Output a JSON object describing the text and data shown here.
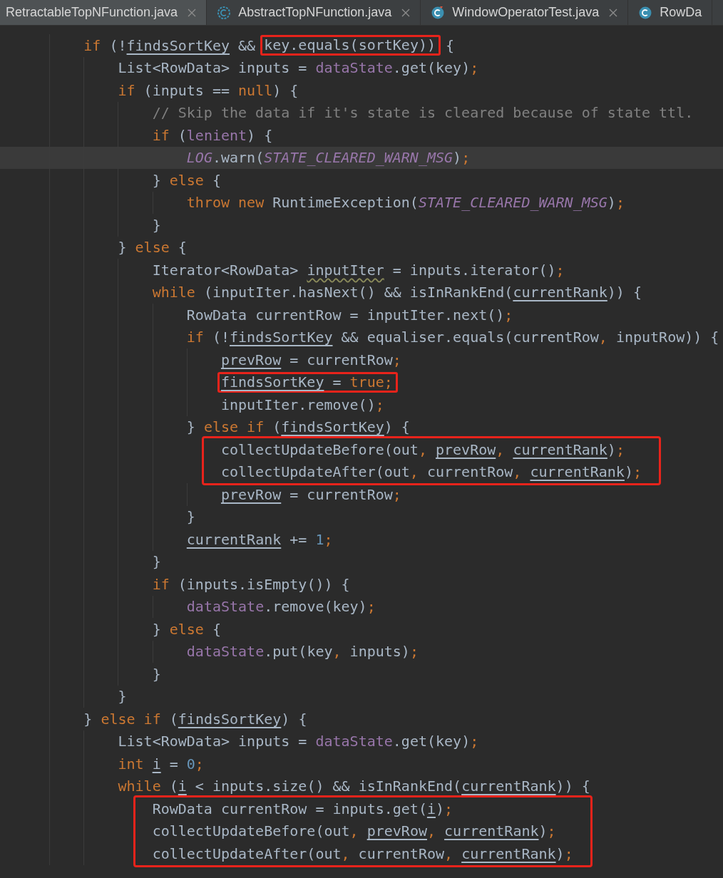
{
  "tabs": [
    {
      "label": "RetractableTopNFunction.java",
      "selected": true,
      "closable": true,
      "kind": "plain"
    },
    {
      "label": "AbstractTopNFunction.java",
      "selected": false,
      "closable": true,
      "kind": "abstract"
    },
    {
      "label": "WindowOperatorTest.java",
      "selected": false,
      "closable": true,
      "kind": "test"
    },
    {
      "label": "RowDa",
      "selected": false,
      "closable": false,
      "kind": "class"
    }
  ],
  "code": [
    {
      "kind": "line",
      "tokens": [
        {
          "kind": "k",
          "text": "if"
        },
        {
          "kind": "t",
          "text": " (!"
        },
        {
          "kind": "u",
          "text": "findsSortKey"
        },
        {
          "kind": "t",
          "text": " && "
        },
        {
          "kind": "box",
          "tokens": [
            {
              "kind": "t",
              "text": "key.equals(sortKey))"
            }
          ]
        },
        {
          "kind": "t",
          "text": " {"
        }
      ],
      "children": [
        {
          "kind": "line",
          "tokens": [
            {
              "kind": "t",
              "text": "List<RowData> inputs = "
            },
            {
              "kind": "f",
              "text": "dataState"
            },
            {
              "kind": "t",
              "text": ".get(key)"
            },
            {
              "kind": "p",
              "text": ";"
            }
          ]
        },
        {
          "kind": "line",
          "tokens": [
            {
              "kind": "k",
              "text": "if"
            },
            {
              "kind": "t",
              "text": " (inputs == "
            },
            {
              "kind": "k",
              "text": "null"
            },
            {
              "kind": "t",
              "text": ") {"
            }
          ],
          "children": [
            {
              "kind": "line",
              "tokens": [
                {
                  "kind": "c",
                  "text": "// Skip the data if it's state is cleared because of state ttl."
                }
              ]
            },
            {
              "kind": "line",
              "tokens": [
                {
                  "kind": "k",
                  "text": "if"
                },
                {
                  "kind": "t",
                  "text": " ("
                },
                {
                  "kind": "f",
                  "text": "lenient"
                },
                {
                  "kind": "t",
                  "text": ") {"
                }
              ],
              "children": [
                {
                  "kind": "line",
                  "current": true,
                  "tokens": [
                    {
                      "kind": "s",
                      "text": "LOG"
                    },
                    {
                      "kind": "t",
                      "text": ".warn("
                    },
                    {
                      "kind": "s",
                      "text": "STATE_CLEARED_WARN_MSG"
                    },
                    {
                      "kind": "t",
                      "text": ")"
                    },
                    {
                      "kind": "p",
                      "text": ";"
                    }
                  ]
                }
              ]
            },
            {
              "kind": "line",
              "tokens": [
                {
                  "kind": "t",
                  "text": "} "
                },
                {
                  "kind": "k",
                  "text": "else"
                },
                {
                  "kind": "t",
                  "text": " {"
                }
              ],
              "children": [
                {
                  "kind": "line",
                  "tokens": [
                    {
                      "kind": "k",
                      "text": "throw new"
                    },
                    {
                      "kind": "t",
                      "text": " RuntimeException("
                    },
                    {
                      "kind": "s",
                      "text": "STATE_CLEARED_WARN_MSG"
                    },
                    {
                      "kind": "t",
                      "text": ")"
                    },
                    {
                      "kind": "p",
                      "text": ";"
                    }
                  ]
                }
              ]
            },
            {
              "kind": "line",
              "tokens": [
                {
                  "kind": "t",
                  "text": "}"
                }
              ]
            }
          ]
        },
        {
          "kind": "line",
          "tokens": [
            {
              "kind": "t",
              "text": "} "
            },
            {
              "kind": "k",
              "text": "else"
            },
            {
              "kind": "t",
              "text": " {"
            }
          ],
          "children": [
            {
              "kind": "line",
              "tokens": [
                {
                  "kind": "t",
                  "text": "Iterator<RowData> "
                },
                {
                  "kind": "w",
                  "text": "inputIter"
                },
                {
                  "kind": "t",
                  "text": " = inputs.iterator()"
                },
                {
                  "kind": "p",
                  "text": ";"
                }
              ]
            },
            {
              "kind": "line",
              "tokens": [
                {
                  "kind": "k",
                  "text": "while"
                },
                {
                  "kind": "t",
                  "text": " (inputIter.hasNext() && isInRankEnd("
                },
                {
                  "kind": "u",
                  "text": "currentRank"
                },
                {
                  "kind": "t",
                  "text": ")) {"
                }
              ],
              "children": [
                {
                  "kind": "line",
                  "tokens": [
                    {
                      "kind": "t",
                      "text": "RowData currentRow = inputIter.next()"
                    },
                    {
                      "kind": "p",
                      "text": ";"
                    }
                  ]
                },
                {
                  "kind": "line",
                  "tokens": [
                    {
                      "kind": "k",
                      "text": "if"
                    },
                    {
                      "kind": "t",
                      "text": " (!"
                    },
                    {
                      "kind": "u",
                      "text": "findsSortKey"
                    },
                    {
                      "kind": "t",
                      "text": " && equaliser.equals(currentRow"
                    },
                    {
                      "kind": "p",
                      "text": ","
                    },
                    {
                      "kind": "t",
                      "text": " inputRow)) {"
                    }
                  ],
                  "children": [
                    {
                      "kind": "line",
                      "tokens": [
                        {
                          "kind": "u",
                          "text": "prevRow"
                        },
                        {
                          "kind": "t",
                          "text": " = currentRow"
                        },
                        {
                          "kind": "p",
                          "text": ";"
                        }
                      ]
                    },
                    {
                      "kind": "line",
                      "tokens": [
                        {
                          "kind": "box",
                          "tokens": [
                            {
                              "kind": "u",
                              "text": "findsSortKey"
                            },
                            {
                              "kind": "t",
                              "text": " = "
                            },
                            {
                              "kind": "k",
                              "text": "true"
                            },
                            {
                              "kind": "p",
                              "text": ";"
                            }
                          ]
                        }
                      ]
                    },
                    {
                      "kind": "line",
                      "tokens": [
                        {
                          "kind": "t",
                          "text": "inputIter.remove()"
                        },
                        {
                          "kind": "p",
                          "text": ";"
                        }
                      ]
                    }
                  ]
                },
                {
                  "kind": "line",
                  "tokens": [
                    {
                      "kind": "t",
                      "text": "} "
                    },
                    {
                      "kind": "k",
                      "text": "else if"
                    },
                    {
                      "kind": "t",
                      "text": " ("
                    },
                    {
                      "kind": "u",
                      "text": "findsSortKey"
                    },
                    {
                      "kind": "t",
                      "text": ") {"
                    }
                  ],
                  "children": [
                    {
                      "kind": "box",
                      "lines": [
                        {
                          "tokens": [
                            {
                              "kind": "t",
                              "text": "collectUpdateBefore(out"
                            },
                            {
                              "kind": "p",
                              "text": ", "
                            },
                            {
                              "kind": "u",
                              "text": "prevRow"
                            },
                            {
                              "kind": "p",
                              "text": ", "
                            },
                            {
                              "kind": "u",
                              "text": "currentRank"
                            },
                            {
                              "kind": "t",
                              "text": ")"
                            },
                            {
                              "kind": "p",
                              "text": ";"
                            }
                          ]
                        },
                        {
                          "tokens": [
                            {
                              "kind": "t",
                              "text": "collectUpdateAfter(out"
                            },
                            {
                              "kind": "p",
                              "text": ","
                            },
                            {
                              "kind": "t",
                              "text": " currentRow"
                            },
                            {
                              "kind": "p",
                              "text": ", "
                            },
                            {
                              "kind": "u",
                              "text": "currentRank"
                            },
                            {
                              "kind": "t",
                              "text": ")"
                            },
                            {
                              "kind": "p",
                              "text": ";"
                            }
                          ]
                        }
                      ]
                    },
                    {
                      "kind": "line",
                      "tokens": [
                        {
                          "kind": "u",
                          "text": "prevRow"
                        },
                        {
                          "kind": "t",
                          "text": " = currentRow"
                        },
                        {
                          "kind": "p",
                          "text": ";"
                        }
                      ]
                    }
                  ]
                },
                {
                  "kind": "line",
                  "tokens": [
                    {
                      "kind": "t",
                      "text": "}"
                    }
                  ]
                },
                {
                  "kind": "line",
                  "tokens": [
                    {
                      "kind": "u",
                      "text": "currentRank"
                    },
                    {
                      "kind": "t",
                      "text": " += "
                    },
                    {
                      "kind": "n",
                      "text": "1"
                    },
                    {
                      "kind": "p",
                      "text": ";"
                    }
                  ]
                }
              ]
            },
            {
              "kind": "line",
              "tokens": [
                {
                  "kind": "t",
                  "text": "}"
                }
              ]
            },
            {
              "kind": "line",
              "tokens": [
                {
                  "kind": "k",
                  "text": "if"
                },
                {
                  "kind": "t",
                  "text": " (inputs.isEmpty()) {"
                }
              ],
              "children": [
                {
                  "kind": "line",
                  "tokens": [
                    {
                      "kind": "f",
                      "text": "dataState"
                    },
                    {
                      "kind": "t",
                      "text": ".remove(key)"
                    },
                    {
                      "kind": "p",
                      "text": ";"
                    }
                  ]
                }
              ]
            },
            {
              "kind": "line",
              "tokens": [
                {
                  "kind": "t",
                  "text": "} "
                },
                {
                  "kind": "k",
                  "text": "else"
                },
                {
                  "kind": "t",
                  "text": " {"
                }
              ],
              "children": [
                {
                  "kind": "line",
                  "tokens": [
                    {
                      "kind": "f",
                      "text": "dataState"
                    },
                    {
                      "kind": "t",
                      "text": ".put(key"
                    },
                    {
                      "kind": "p",
                      "text": ","
                    },
                    {
                      "kind": "t",
                      "text": " inputs)"
                    },
                    {
                      "kind": "p",
                      "text": ";"
                    }
                  ]
                }
              ]
            },
            {
              "kind": "line",
              "tokens": [
                {
                  "kind": "t",
                  "text": "}"
                }
              ]
            }
          ]
        },
        {
          "kind": "line",
          "tokens": [
            {
              "kind": "t",
              "text": "}"
            }
          ]
        }
      ]
    },
    {
      "kind": "line",
      "tokens": [
        {
          "kind": "t",
          "text": "} "
        },
        {
          "kind": "k",
          "text": "else if"
        },
        {
          "kind": "t",
          "text": " ("
        },
        {
          "kind": "u",
          "text": "findsSortKey"
        },
        {
          "kind": "t",
          "text": ") {"
        }
      ],
      "children": [
        {
          "kind": "line",
          "tokens": [
            {
              "kind": "t",
              "text": "List<RowData> inputs = "
            },
            {
              "kind": "f",
              "text": "dataState"
            },
            {
              "kind": "t",
              "text": ".get(key)"
            },
            {
              "kind": "p",
              "text": ";"
            }
          ]
        },
        {
          "kind": "line",
          "tokens": [
            {
              "kind": "k",
              "text": "int "
            },
            {
              "kind": "u",
              "text": "i"
            },
            {
              "kind": "t",
              "text": " = "
            },
            {
              "kind": "n",
              "text": "0"
            },
            {
              "kind": "p",
              "text": ";"
            }
          ]
        },
        {
          "kind": "line",
          "tokens": [
            {
              "kind": "k",
              "text": "while"
            },
            {
              "kind": "t",
              "text": " ("
            },
            {
              "kind": "u",
              "text": "i"
            },
            {
              "kind": "t",
              "text": " < inputs.size() && isInRankEnd("
            },
            {
              "kind": "u",
              "text": "currentRank"
            },
            {
              "kind": "t",
              "text": ")) {"
            }
          ],
          "children": [
            {
              "kind": "box",
              "lines": [
                {
                  "tokens": [
                    {
                      "kind": "t",
                      "text": "RowData currentRow = inputs.get("
                    },
                    {
                      "kind": "u",
                      "text": "i"
                    },
                    {
                      "kind": "t",
                      "text": ")"
                    },
                    {
                      "kind": "p",
                      "text": ";"
                    }
                  ]
                },
                {
                  "tokens": [
                    {
                      "kind": "t",
                      "text": "collectUpdateBefore(out"
                    },
                    {
                      "kind": "p",
                      "text": ", "
                    },
                    {
                      "kind": "u",
                      "text": "prevRow"
                    },
                    {
                      "kind": "p",
                      "text": ", "
                    },
                    {
                      "kind": "u",
                      "text": "currentRank"
                    },
                    {
                      "kind": "t",
                      "text": ")"
                    },
                    {
                      "kind": "p",
                      "text": ";"
                    }
                  ]
                },
                {
                  "tokens": [
                    {
                      "kind": "t",
                      "text": "collectUpdateAfter(out"
                    },
                    {
                      "kind": "p",
                      "text": ","
                    },
                    {
                      "kind": "t",
                      "text": " currentRow"
                    },
                    {
                      "kind": "p",
                      "text": ", "
                    },
                    {
                      "kind": "u",
                      "text": "currentRank"
                    },
                    {
                      "kind": "t",
                      "text": ")"
                    },
                    {
                      "kind": "p",
                      "text": ";"
                    }
                  ]
                }
              ]
            }
          ]
        }
      ]
    }
  ]
}
